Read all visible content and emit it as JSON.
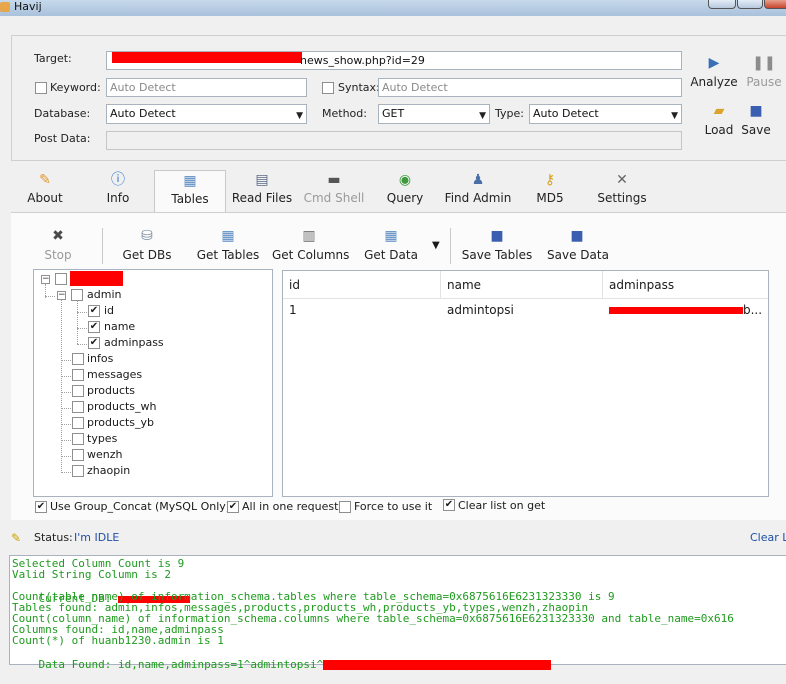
{
  "window": {
    "title": "Havij"
  },
  "target": {
    "label": "Target:",
    "url_visible": "news_show.php?id=29",
    "keyword_label": "Keyword:",
    "keyword_placeholder": "Auto Detect",
    "syntax_label": "Syntax:",
    "syntax_placeholder": "Auto Detect",
    "database_label": "Database:",
    "database_value": "Auto Detect",
    "method_label": "Method:",
    "method_value": "GET",
    "type_label": "Type:",
    "type_value": "Auto Detect",
    "postdata_label": "Post Data:"
  },
  "side_buttons": {
    "analyze": "Analyze",
    "pause": "Pause",
    "load": "Load",
    "save": "Save"
  },
  "main_tabs": [
    "About",
    "Info",
    "Tables",
    "Read Files",
    "Cmd Shell",
    "Query",
    "Find Admin",
    "MD5",
    "Settings"
  ],
  "active_tab": "Tables",
  "toolbar": {
    "stop": "Stop",
    "get_dbs": "Get DBs",
    "get_tables": "Get Tables",
    "get_columns": "Get Columns",
    "get_data": "Get Data",
    "save_tables": "Save Tables",
    "save_data": "Save Data"
  },
  "tree": {
    "table_admin": "admin",
    "columns": [
      {
        "name": "id",
        "checked": true
      },
      {
        "name": "name",
        "checked": true
      },
      {
        "name": "adminpass",
        "checked": true
      }
    ],
    "other_tables": [
      "infos",
      "messages",
      "products",
      "products_wh",
      "products_yb",
      "types",
      "wenzh",
      "zhaopin"
    ]
  },
  "grid": {
    "headers": [
      "id",
      "name",
      "adminpass"
    ],
    "row1": {
      "id": "1",
      "name": "admintopsi",
      "adminpass_tail": "b..."
    }
  },
  "options": {
    "group_concat": {
      "label": "Use Group_Concat (MySQL Only)",
      "checked": true
    },
    "all_in_one": {
      "label": "All in one request.",
      "checked": true
    },
    "force": {
      "label": "Force to use it",
      "checked": false
    },
    "clear_list": {
      "label": "Clear list on get",
      "checked": true
    }
  },
  "status": {
    "label": "Status:",
    "value": "I'm IDLE",
    "clear_log": "Clear Lo"
  },
  "log": [
    "Selected Column Count is 9",
    "Valid String Column is 2",
    "Current DB: ",
    "Count(table_name) of information_schema.tables where table_schema=0x6875616E6231323330 is 9",
    "Tables found: admin,infos,messages,products,products_wh,products_yb,types,wenzh,zhaopin",
    "Count(column_name) of information_schema.columns where table_schema=0x6875616E6231323330 and table_name=0x616",
    "Columns found: id,name,adminpass",
    "Count(*) of huanb1230.admin is 1",
    "Data Found: id,name,adminpass=1^admintopsi^"
  ],
  "colors": {
    "log_text": "#1e9a1e",
    "status_value": "#1f4fa8",
    "redaction": "#ff0000"
  }
}
